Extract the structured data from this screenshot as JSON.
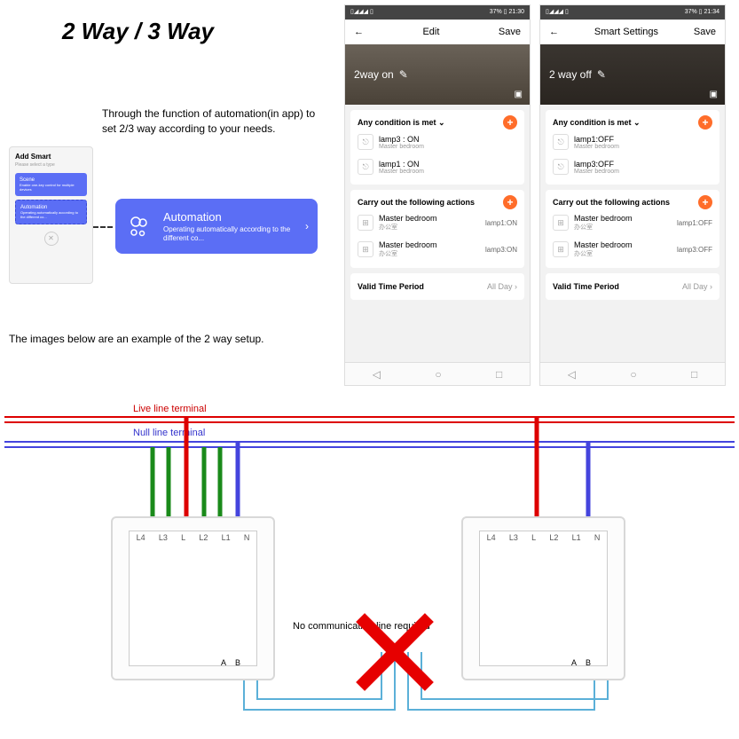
{
  "title": "2 Way / 3 Way",
  "desc": "Through the function of  automation(in app) to set  2/3 way according to your needs.",
  "desc2": "The images below are an example of the 2 way setup.",
  "mini": {
    "hdr": "Add Smart",
    "sub": "Please select a type",
    "card1": "Scene",
    "card1_sub": "Enable one-key control for multiple devices",
    "card2": "Automation",
    "card2_sub": "Operating automatically according to the different co..."
  },
  "autoCard": {
    "title": "Automation",
    "sub": "Operating automatically according to the different co..."
  },
  "statusbar": {
    "left": "▯◢◢◢ ▯",
    "right1": "37% ▯ 21:30",
    "right2": "37% ▯ 21:34"
  },
  "p1": {
    "head_title": "Edit",
    "save": "Save",
    "banner": "2way on",
    "cond": "Any condition is met",
    "carry": "Carry out the following actions",
    "valid": "Valid Time Period",
    "allday": "All Day",
    "c1": {
      "t": "lamp3 : ON",
      "s": "Master bedroom"
    },
    "c2": {
      "t": "lamp1 : ON",
      "s": "Master bedroom"
    },
    "a1": {
      "t": "Master bedroom",
      "s": "办公室",
      "r": "lamp1:ON"
    },
    "a2": {
      "t": "Master bedroom",
      "s": "办公室",
      "r": "lamp3:ON"
    }
  },
  "p2": {
    "head_title": "Smart Settings",
    "save": "Save",
    "banner": "2 way off",
    "cond": "Any condition is met",
    "carry": "Carry out the following actions",
    "valid": "Valid Time Period",
    "allday": "All Day",
    "c1": {
      "t": "lamp1:OFF",
      "s": "Master bedroom"
    },
    "c2": {
      "t": "lamp3:OFF",
      "s": "Master bedroom"
    },
    "a1": {
      "t": "Master bedroom",
      "s": "办公室",
      "r": "lamp1:OFF"
    },
    "a2": {
      "t": "Master bedroom",
      "s": "办公室",
      "r": "lamp3:OFF"
    }
  },
  "wiring": {
    "live": "Live line terminal",
    "null": "Null line terminal",
    "nocomm": "No communication line required",
    "terms": [
      "L4",
      "L3",
      "L",
      "L2",
      "L1",
      "N"
    ],
    "ab": [
      "A",
      "B"
    ]
  }
}
